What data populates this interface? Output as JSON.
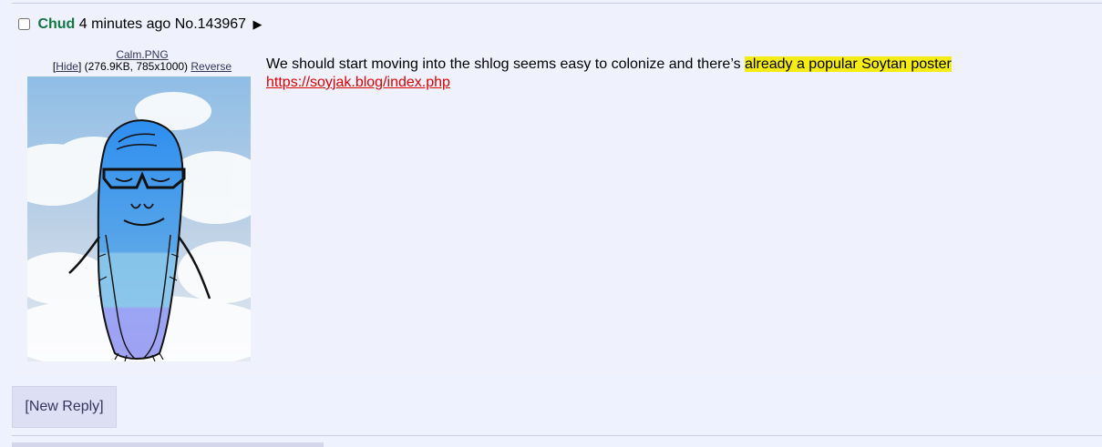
{
  "post": {
    "name": "Chud",
    "time": "4 minutes ago",
    "number_label": "No.143967",
    "expand_icon": "play-icon",
    "file": {
      "filename": "Calm.PNG",
      "hide_open_bracket": "[",
      "hide_label": "Hide",
      "hide_close_bracket": "]",
      "details": "(276.9KB, 785x1000)",
      "reverse_label": "Reverse",
      "image_description": "blue soyjak face with glasses and beard on a cloudy sky background"
    },
    "message": {
      "text_before_highlight": "We should start moving into the shlog seems easy to colonize and there’s ",
      "highlighted_text": "already a popular Soytan poster",
      "link": "https://soyjak.blog/index.php"
    }
  },
  "actions": {
    "new_reply": "[New Reply]"
  },
  "colors": {
    "background": "#eef2ff",
    "name": "#117743",
    "link": "#dd0000",
    "highlight": "#f4ec13",
    "button_background": "#dde0f4"
  }
}
